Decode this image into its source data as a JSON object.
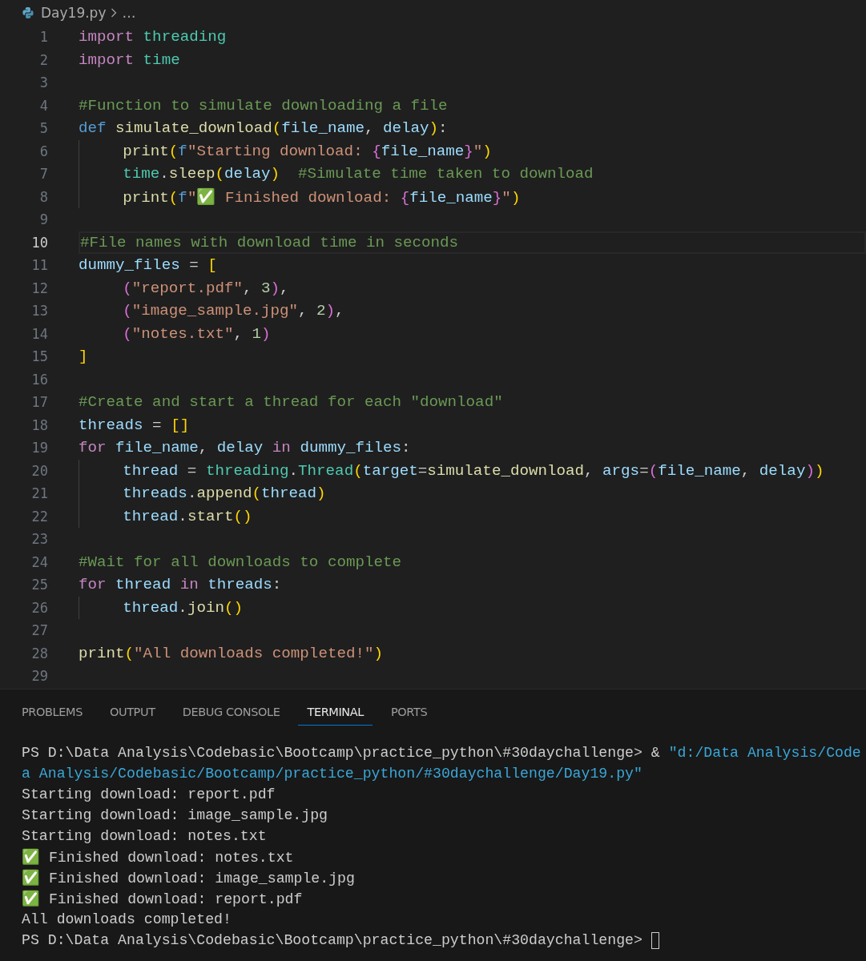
{
  "breadcrumb": {
    "file": "Day19.py",
    "more": "…"
  },
  "editor": {
    "lines": [
      {
        "number": "1",
        "current": false,
        "guide": false,
        "indented": false,
        "tokens": [
          {
            "kind": "kw",
            "text": "import "
          },
          {
            "kind": "mod",
            "text": "threading"
          }
        ]
      },
      {
        "number": "2",
        "current": false,
        "guide": false,
        "indented": false,
        "tokens": [
          {
            "kind": "kw",
            "text": "import "
          },
          {
            "kind": "mod",
            "text": "time"
          }
        ]
      },
      {
        "number": "3",
        "current": false,
        "guide": false
      },
      {
        "number": "4",
        "current": false,
        "guide": false,
        "indented": false,
        "tokens": [
          {
            "kind": "cmt",
            "text": "#Function to simulate downloading a file"
          }
        ]
      },
      {
        "number": "5",
        "current": false,
        "guide": false,
        "indented": false,
        "tokens": [
          {
            "kind": "def",
            "text": "def "
          },
          {
            "kind": "fn",
            "text": "simulate_download"
          },
          {
            "kind": "b1",
            "text": "("
          },
          {
            "kind": "var",
            "text": "file_name"
          },
          {
            "kind": "punc",
            "text": ", "
          },
          {
            "kind": "var",
            "text": "delay"
          },
          {
            "kind": "b1",
            "text": ")"
          },
          {
            "kind": "punc",
            "text": ":"
          }
        ]
      },
      {
        "number": "6",
        "current": false,
        "guide": true,
        "indented": true,
        "tokens": [
          {
            "kind": "fn",
            "text": "print"
          },
          {
            "kind": "b1",
            "text": "("
          },
          {
            "kind": "def",
            "text": "f"
          },
          {
            "kind": "str",
            "text": "\"Starting download: "
          },
          {
            "kind": "b2",
            "text": "{"
          },
          {
            "kind": "var",
            "text": "file_name"
          },
          {
            "kind": "b2",
            "text": "}"
          },
          {
            "kind": "str",
            "text": "\""
          },
          {
            "kind": "b1",
            "text": ")"
          }
        ]
      },
      {
        "number": "7",
        "current": false,
        "guide": true,
        "indented": true,
        "tokens": [
          {
            "kind": "mod",
            "text": "time"
          },
          {
            "kind": "punc",
            "text": "."
          },
          {
            "kind": "fn",
            "text": "sleep"
          },
          {
            "kind": "b1",
            "text": "("
          },
          {
            "kind": "var",
            "text": "delay"
          },
          {
            "kind": "b1",
            "text": ")"
          },
          {
            "kind": "cmt",
            "text": "  #Simulate time taken to download"
          }
        ]
      },
      {
        "number": "8",
        "current": false,
        "guide": true,
        "indented": true,
        "tokens": [
          {
            "kind": "fn",
            "text": "print"
          },
          {
            "kind": "b1",
            "text": "("
          },
          {
            "kind": "def",
            "text": "f"
          },
          {
            "kind": "str",
            "text": "\"✅ Finished download: "
          },
          {
            "kind": "b2",
            "text": "{"
          },
          {
            "kind": "var",
            "text": "file_name"
          },
          {
            "kind": "b2",
            "text": "}"
          },
          {
            "kind": "str",
            "text": "\""
          },
          {
            "kind": "b1",
            "text": ")"
          }
        ]
      },
      {
        "number": "9",
        "current": false,
        "guide": false
      },
      {
        "number": "10",
        "current": true,
        "guide": false,
        "indented": false,
        "tokens": [
          {
            "kind": "cmt",
            "text": "#File names with download time in seconds"
          }
        ]
      },
      {
        "number": "11",
        "current": false,
        "guide": false,
        "indented": false,
        "tokens": [
          {
            "kind": "var",
            "text": "dummy_files"
          },
          {
            "kind": "punc",
            "text": " = "
          },
          {
            "kind": "b1",
            "text": "["
          }
        ]
      },
      {
        "number": "12",
        "current": false,
        "guide": false,
        "indented": true,
        "tokens": [
          {
            "kind": "b2",
            "text": "("
          },
          {
            "kind": "str",
            "text": "\"report.pdf\""
          },
          {
            "kind": "punc",
            "text": ", "
          },
          {
            "kind": "num",
            "text": "3"
          },
          {
            "kind": "b2",
            "text": ")"
          },
          {
            "kind": "punc",
            "text": ","
          }
        ]
      },
      {
        "number": "13",
        "current": false,
        "guide": false,
        "indented": true,
        "tokens": [
          {
            "kind": "b2",
            "text": "("
          },
          {
            "kind": "str",
            "text": "\"image_sample.jpg\""
          },
          {
            "kind": "punc",
            "text": ", "
          },
          {
            "kind": "num",
            "text": "2"
          },
          {
            "kind": "b2",
            "text": ")"
          },
          {
            "kind": "punc",
            "text": ","
          }
        ]
      },
      {
        "number": "14",
        "current": false,
        "guide": false,
        "indented": true,
        "tokens": [
          {
            "kind": "b2",
            "text": "("
          },
          {
            "kind": "str",
            "text": "\"notes.txt\""
          },
          {
            "kind": "punc",
            "text": ", "
          },
          {
            "kind": "num",
            "text": "1"
          },
          {
            "kind": "b2",
            "text": ")"
          }
        ]
      },
      {
        "number": "15",
        "current": false,
        "guide": false,
        "indented": false,
        "tokens": [
          {
            "kind": "b1",
            "text": "]"
          }
        ]
      },
      {
        "number": "16",
        "current": false,
        "guide": false
      },
      {
        "number": "17",
        "current": false,
        "guide": false,
        "indented": false,
        "tokens": [
          {
            "kind": "cmt",
            "text": "#Create and start a thread for each \"download\""
          }
        ]
      },
      {
        "number": "18",
        "current": false,
        "guide": false,
        "indented": false,
        "tokens": [
          {
            "kind": "var",
            "text": "threads"
          },
          {
            "kind": "punc",
            "text": " = "
          },
          {
            "kind": "b1",
            "text": "[]"
          }
        ]
      },
      {
        "number": "19",
        "current": false,
        "guide": false,
        "indented": false,
        "tokens": [
          {
            "kind": "kw",
            "text": "for "
          },
          {
            "kind": "var",
            "text": "file_name"
          },
          {
            "kind": "punc",
            "text": ", "
          },
          {
            "kind": "var",
            "text": "delay "
          },
          {
            "kind": "kw",
            "text": "in "
          },
          {
            "kind": "var",
            "text": "dummy_files"
          },
          {
            "kind": "punc",
            "text": ":"
          }
        ]
      },
      {
        "number": "20",
        "current": false,
        "guide": true,
        "indented": true,
        "tokens": [
          {
            "kind": "var",
            "text": "thread"
          },
          {
            "kind": "punc",
            "text": " = "
          },
          {
            "kind": "mod",
            "text": "threading"
          },
          {
            "kind": "punc",
            "text": "."
          },
          {
            "kind": "mod",
            "text": "Thread"
          },
          {
            "kind": "b1",
            "text": "("
          },
          {
            "kind": "var",
            "text": "target"
          },
          {
            "kind": "punc",
            "text": "="
          },
          {
            "kind": "fn",
            "text": "simulate_download"
          },
          {
            "kind": "punc",
            "text": ", "
          },
          {
            "kind": "var",
            "text": "args"
          },
          {
            "kind": "punc",
            "text": "="
          },
          {
            "kind": "b2",
            "text": "("
          },
          {
            "kind": "var",
            "text": "file_name"
          },
          {
            "kind": "punc",
            "text": ", "
          },
          {
            "kind": "var",
            "text": "delay"
          },
          {
            "kind": "b2",
            "text": ")"
          },
          {
            "kind": "b1",
            "text": ")"
          }
        ]
      },
      {
        "number": "21",
        "current": false,
        "guide": true,
        "indented": true,
        "tokens": [
          {
            "kind": "var",
            "text": "threads"
          },
          {
            "kind": "punc",
            "text": "."
          },
          {
            "kind": "fn",
            "text": "append"
          },
          {
            "kind": "b1",
            "text": "("
          },
          {
            "kind": "var",
            "text": "thread"
          },
          {
            "kind": "b1",
            "text": ")"
          }
        ]
      },
      {
        "number": "22",
        "current": false,
        "guide": true,
        "indented": true,
        "tokens": [
          {
            "kind": "var",
            "text": "thread"
          },
          {
            "kind": "punc",
            "text": "."
          },
          {
            "kind": "fn",
            "text": "start"
          },
          {
            "kind": "b1",
            "text": "()"
          }
        ]
      },
      {
        "number": "23",
        "current": false,
        "guide": false
      },
      {
        "number": "24",
        "current": false,
        "guide": false,
        "indented": false,
        "tokens": [
          {
            "kind": "cmt",
            "text": "#Wait for all downloads to complete"
          }
        ]
      },
      {
        "number": "25",
        "current": false,
        "guide": false,
        "indented": false,
        "tokens": [
          {
            "kind": "kw",
            "text": "for "
          },
          {
            "kind": "var",
            "text": "thread "
          },
          {
            "kind": "kw",
            "text": "in "
          },
          {
            "kind": "var",
            "text": "threads"
          },
          {
            "kind": "punc",
            "text": ":"
          }
        ]
      },
      {
        "number": "26",
        "current": false,
        "guide": true,
        "indented": true,
        "tokens": [
          {
            "kind": "var",
            "text": "thread"
          },
          {
            "kind": "punc",
            "text": "."
          },
          {
            "kind": "fn",
            "text": "join"
          },
          {
            "kind": "b1",
            "text": "()"
          }
        ]
      },
      {
        "number": "27",
        "current": false,
        "guide": false
      },
      {
        "number": "28",
        "current": false,
        "guide": false,
        "indented": false,
        "tokens": [
          {
            "kind": "fn",
            "text": "print"
          },
          {
            "kind": "b1",
            "text": "("
          },
          {
            "kind": "str",
            "text": "\"All downloads completed!\""
          },
          {
            "kind": "b1",
            "text": ")"
          }
        ]
      },
      {
        "number": "29",
        "current": false,
        "guide": false
      }
    ]
  },
  "panel": {
    "tabs": [
      {
        "label": "PROBLEMS",
        "selected": false
      },
      {
        "label": "OUTPUT",
        "selected": false
      },
      {
        "label": "DEBUG CONSOLE",
        "selected": false
      },
      {
        "label": "TERMINAL",
        "selected": true
      },
      {
        "label": "PORTS",
        "selected": false
      }
    ],
    "terminal": {
      "lines": [
        {
          "segments": [
            {
              "kind": "out",
              "text": "PS D:\\Data Analysis\\Codebasic\\Bootcamp\\practice_python\\#30daychallenge> & "
            },
            {
              "kind": "path",
              "text": "\"d:/Data Analysis/Code"
            }
          ]
        },
        {
          "cursor": false,
          "segments": [
            {
              "kind": "path",
              "text": "a Analysis/Codebasic/Bootcamp/practice_python/#30daychallenge/Day19.py\""
            }
          ]
        },
        {
          "cursor": false,
          "segments": [
            {
              "kind": "out",
              "text": "Starting download: report.pdf"
            }
          ]
        },
        {
          "cursor": false,
          "segments": [
            {
              "kind": "out",
              "text": "Starting download: image_sample.jpg"
            }
          ]
        },
        {
          "cursor": false,
          "segments": [
            {
              "kind": "out",
              "text": "Starting download: notes.txt"
            }
          ]
        },
        {
          "cursor": false,
          "segments": [
            {
              "kind": "out",
              "text": "✅ Finished download: notes.txt"
            }
          ]
        },
        {
          "cursor": false,
          "segments": [
            {
              "kind": "out",
              "text": "✅ Finished download: image_sample.jpg"
            }
          ]
        },
        {
          "cursor": false,
          "segments": [
            {
              "kind": "out",
              "text": "✅ Finished download: report.pdf"
            }
          ]
        },
        {
          "cursor": false,
          "segments": [
            {
              "kind": "out",
              "text": "All downloads completed!"
            }
          ]
        },
        {
          "cursor": true,
          "segments": [
            {
              "kind": "out",
              "text": "PS D:\\Data Analysis\\Codebasic\\Bootcamp\\practice_python\\#30daychallenge>"
            }
          ]
        }
      ]
    }
  }
}
